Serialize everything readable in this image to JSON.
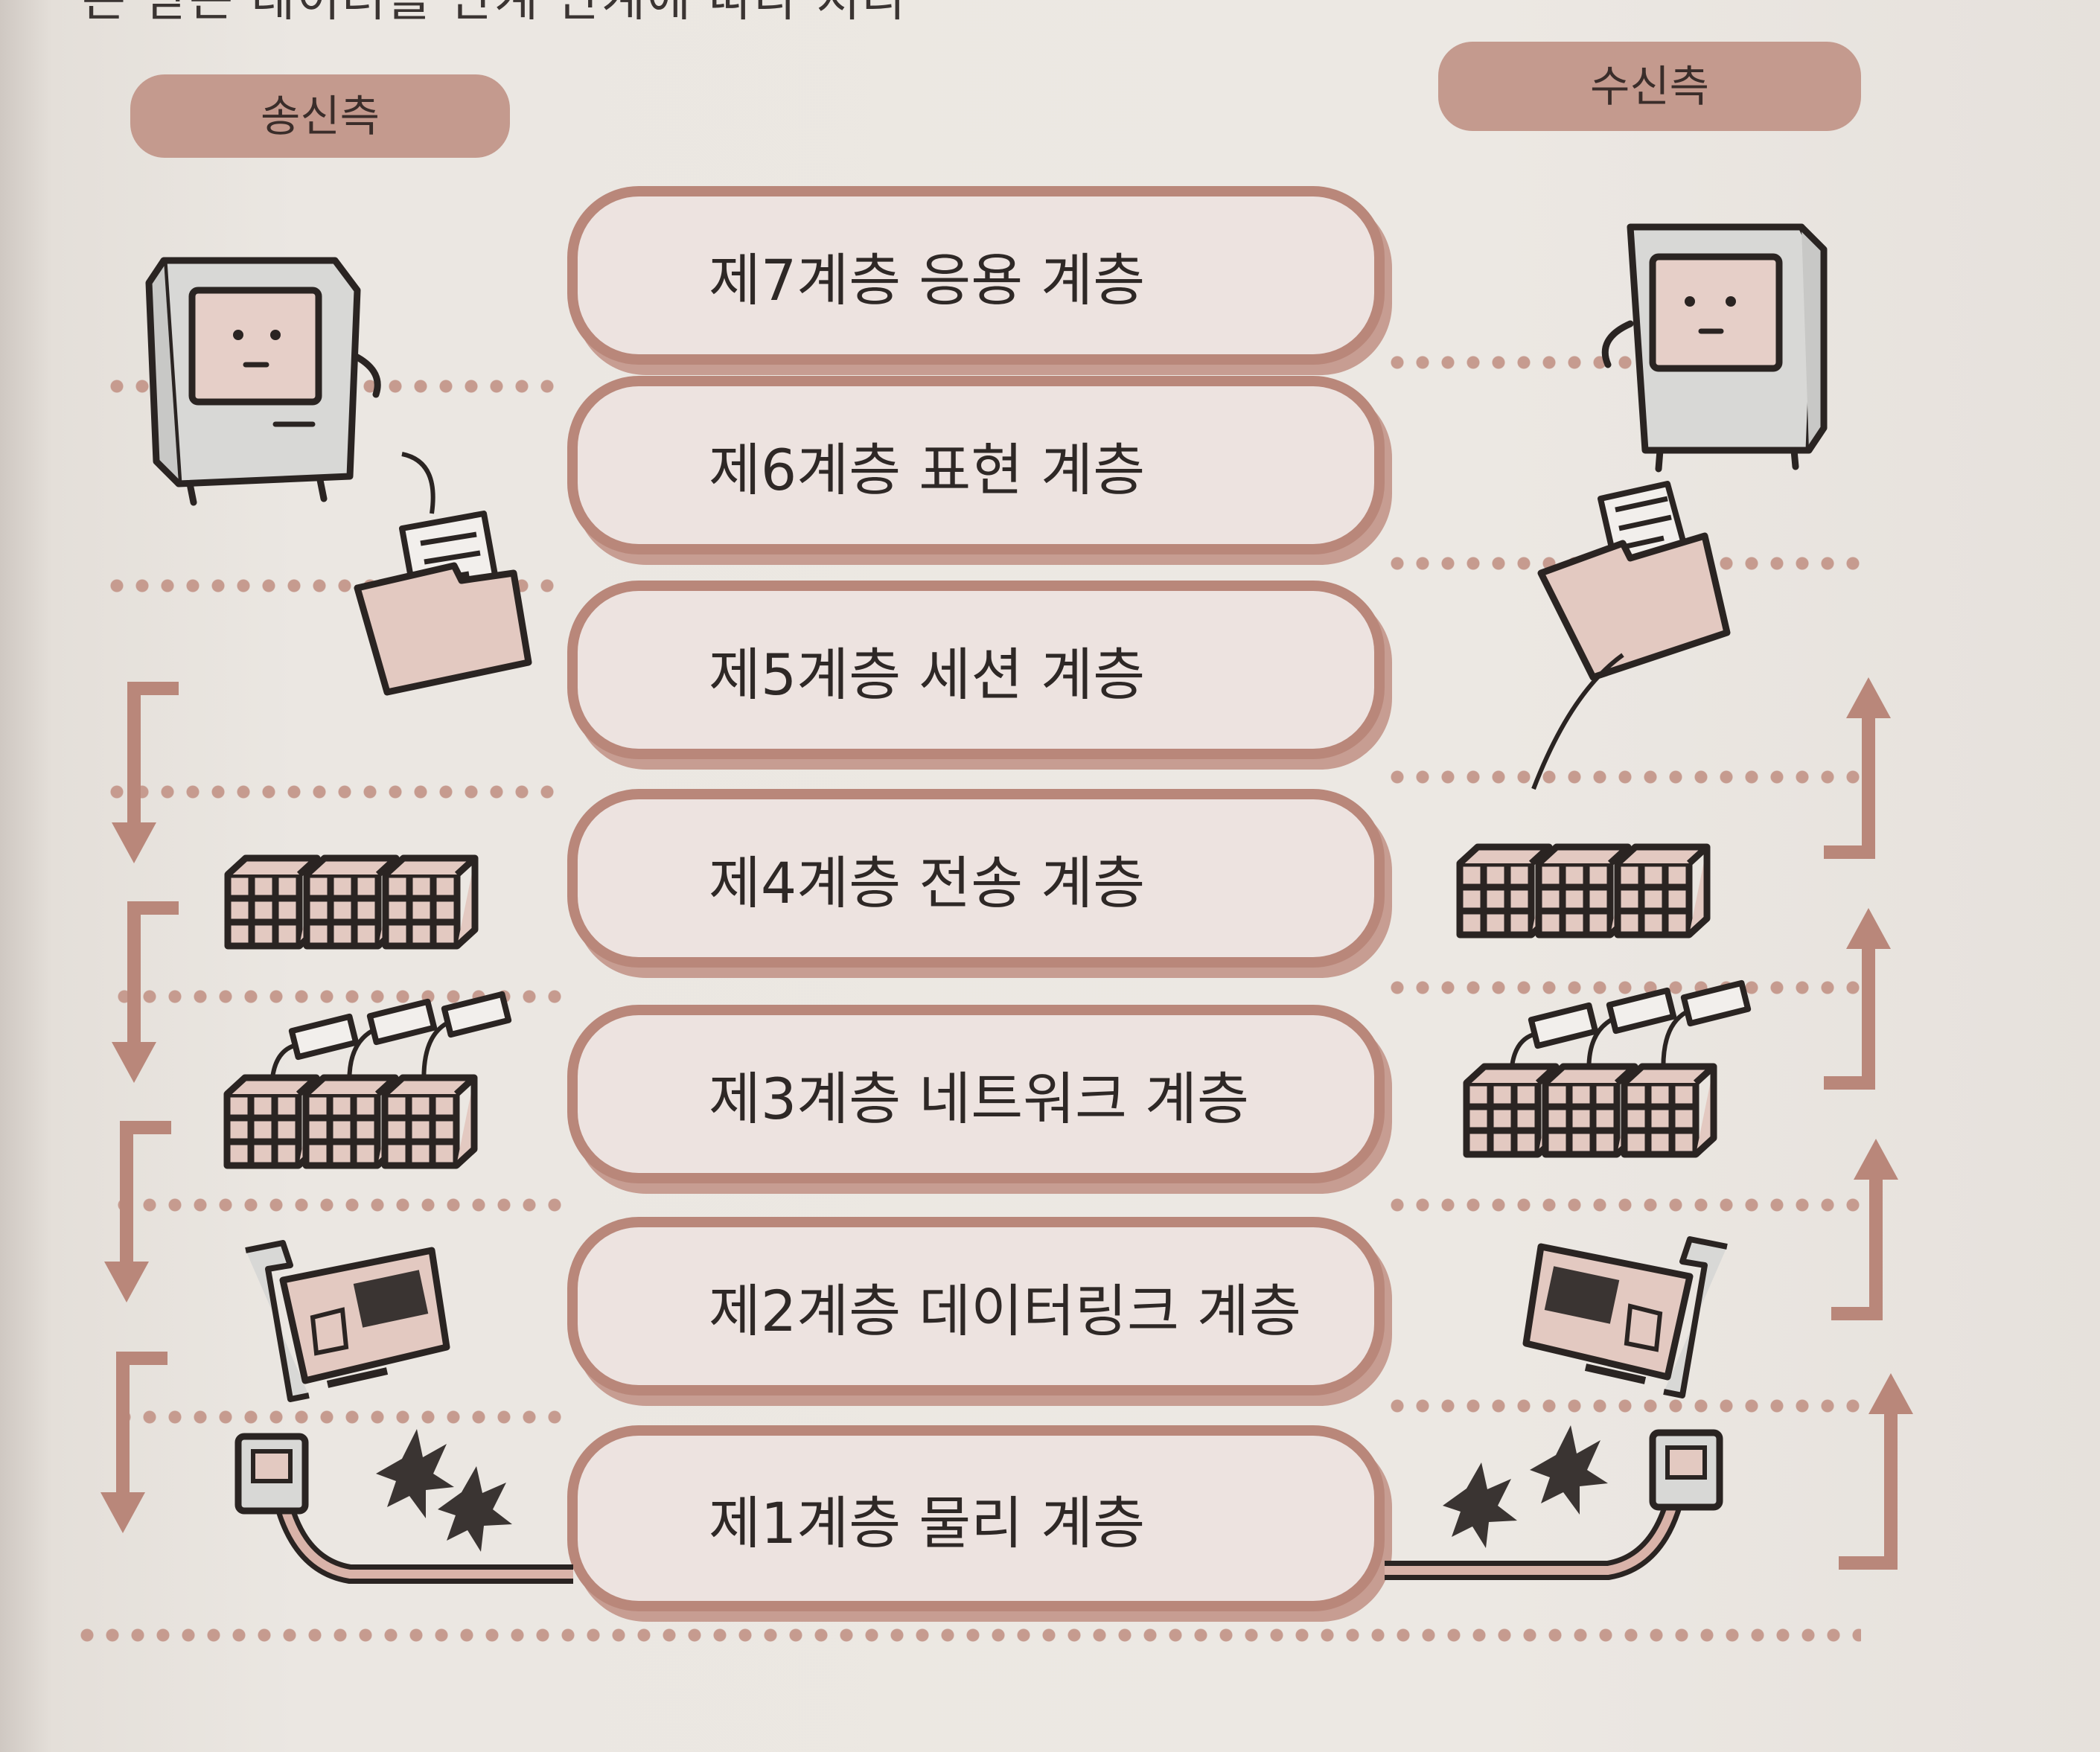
{
  "header": {
    "top_text": "은 받는 데이터를 단계 단계에 따라 처리"
  },
  "sender": {
    "label": "송신측"
  },
  "receiver": {
    "label": "수신측"
  },
  "layers": [
    {
      "label": "제7계층 응용 계층"
    },
    {
      "label": "제6계층 표현 계층"
    },
    {
      "label": "제5계층 세션 계층"
    },
    {
      "label": "제4계층 전송 계층"
    },
    {
      "label": "제3계층 네트워크 계층"
    },
    {
      "label": "제2계층 데이터링크 계층"
    },
    {
      "label": "제1계층 물리 계층"
    }
  ],
  "icons": {
    "computer": "computer-character-icon",
    "folder": "document-folder-icon",
    "segments": "data-packet-boxes-icon",
    "packets": "tagged-packet-boxes-icon",
    "network_card": "network-card-icon",
    "cable": "cable-with-signal-sparks-icon"
  },
  "colors": {
    "accent": "#b9877a",
    "pill": "#c49a8e",
    "dots": "#c69b8f",
    "box_fill": "#ede3e0"
  }
}
